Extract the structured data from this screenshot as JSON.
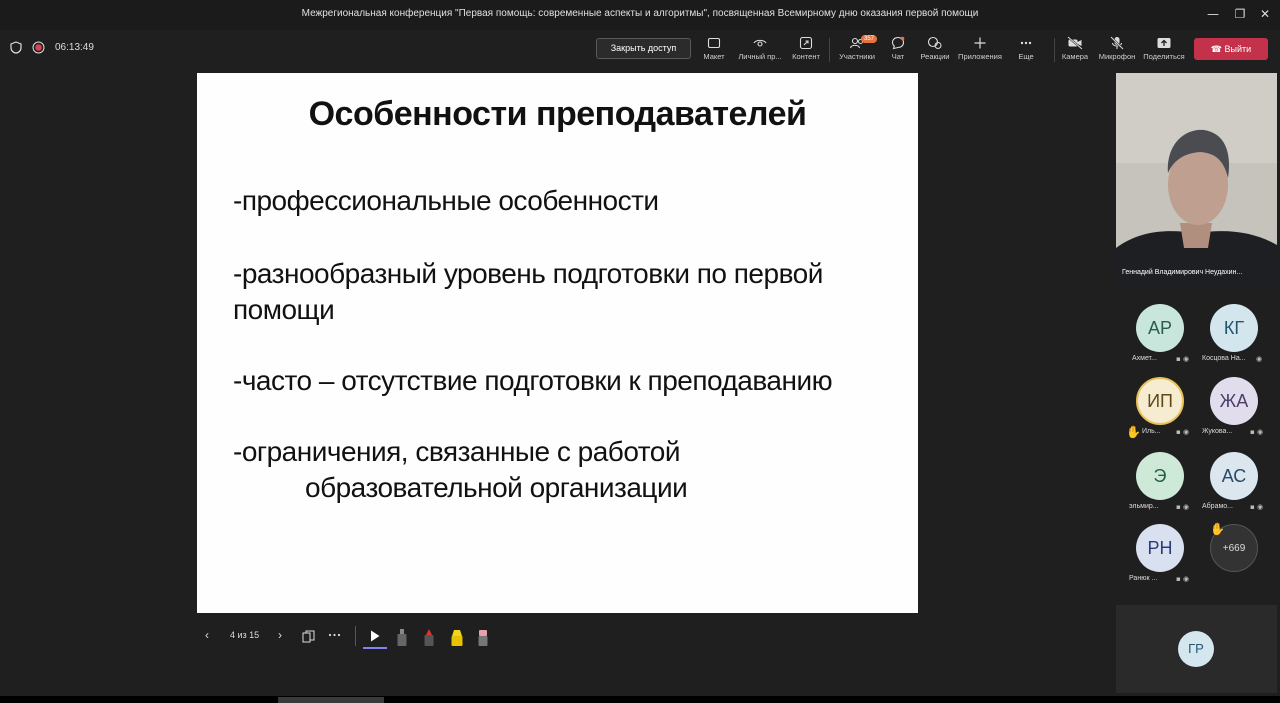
{
  "window": {
    "title": "Межрегиональная конференция \"Первая помощь: современные аспекты и алгоритмы\", посвященная Всемирному дню оказания первой помощи"
  },
  "toolbar": {
    "timer": "06:13:49",
    "close_access": "Закрыть доступ",
    "participants_count": "357",
    "buttons": {
      "layout": "Макет",
      "personal": "Личный пр...",
      "content": "Контент",
      "participants": "Участники",
      "chat": "Чат",
      "reactions": "Реакции",
      "apps": "Приложения",
      "more": "Еще",
      "camera": "Камера",
      "mic": "Микрофон",
      "share": "Поделиться"
    },
    "leave": "Выйти",
    "leave_color": "#c4314b"
  },
  "slide": {
    "title": "Особенности преподавателей",
    "b1": "-профессиональные особенности",
    "b2a": "-разнообразный уровень подготовки по первой",
    "b2b": "помощи",
    "b3": "-часто – отсутствие подготовки к преподаванию",
    "b4a": "-ограничения, связанные с работой",
    "b4b": "образовательной организации"
  },
  "slide_controls": {
    "page": "4 из 15"
  },
  "speaker": {
    "name": "Геннадий Владимирович Неудахин..."
  },
  "participants": [
    {
      "initials": "АР",
      "name": "Ахмет...",
      "bg": "#c9e6dc",
      "fg": "#2b5d4f"
    },
    {
      "initials": "КГ",
      "name": "Косцова На...",
      "bg": "#d3e6ee",
      "fg": "#245570"
    },
    {
      "initials": "ИП",
      "name": "Иль...",
      "bg": "#f5ecd2",
      "fg": "#5e4a17"
    },
    {
      "initials": "ЖА",
      "name": "Жукова...",
      "bg": "#e2ddec",
      "fg": "#4c3d6a"
    },
    {
      "initials": "Э",
      "name": "эльмир...",
      "bg": "#cfe9d9",
      "fg": "#22603e"
    },
    {
      "initials": "АС",
      "name": "Абрамо...",
      "bg": "#dbe6ee",
      "fg": "#274a68"
    },
    {
      "initials": "РН",
      "name": "Ранюк ...",
      "bg": "#d9e1f1",
      "fg": "#2a3d7a"
    }
  ],
  "more_participants": "+669",
  "bottom_avatar": {
    "initials": "ГР",
    "bg": "#d4e6ee",
    "fg": "#265672"
  }
}
